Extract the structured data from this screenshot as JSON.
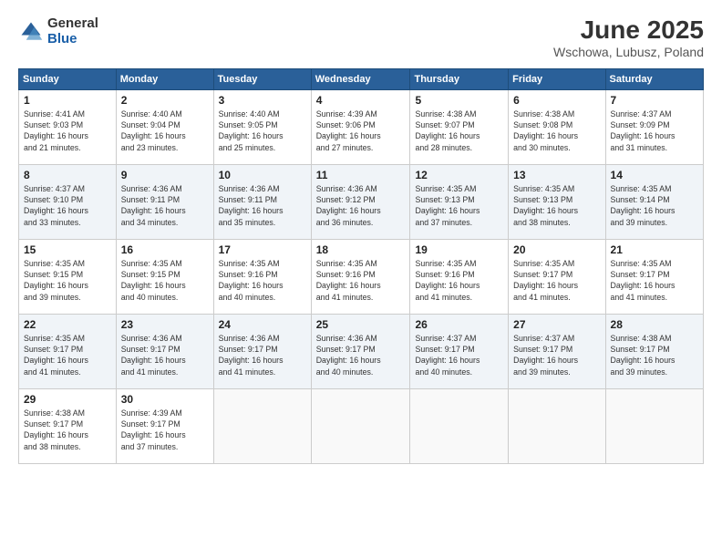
{
  "logo": {
    "line1": "General",
    "line2": "Blue"
  },
  "title": "June 2025",
  "subtitle": "Wschowa, Lubusz, Poland",
  "header_days": [
    "Sunday",
    "Monday",
    "Tuesday",
    "Wednesday",
    "Thursday",
    "Friday",
    "Saturday"
  ],
  "weeks": [
    [
      {
        "day": "1",
        "info": "Sunrise: 4:41 AM\nSunset: 9:03 PM\nDaylight: 16 hours\nand 21 minutes."
      },
      {
        "day": "2",
        "info": "Sunrise: 4:40 AM\nSunset: 9:04 PM\nDaylight: 16 hours\nand 23 minutes."
      },
      {
        "day": "3",
        "info": "Sunrise: 4:40 AM\nSunset: 9:05 PM\nDaylight: 16 hours\nand 25 minutes."
      },
      {
        "day": "4",
        "info": "Sunrise: 4:39 AM\nSunset: 9:06 PM\nDaylight: 16 hours\nand 27 minutes."
      },
      {
        "day": "5",
        "info": "Sunrise: 4:38 AM\nSunset: 9:07 PM\nDaylight: 16 hours\nand 28 minutes."
      },
      {
        "day": "6",
        "info": "Sunrise: 4:38 AM\nSunset: 9:08 PM\nDaylight: 16 hours\nand 30 minutes."
      },
      {
        "day": "7",
        "info": "Sunrise: 4:37 AM\nSunset: 9:09 PM\nDaylight: 16 hours\nand 31 minutes."
      }
    ],
    [
      {
        "day": "8",
        "info": "Sunrise: 4:37 AM\nSunset: 9:10 PM\nDaylight: 16 hours\nand 33 minutes."
      },
      {
        "day": "9",
        "info": "Sunrise: 4:36 AM\nSunset: 9:11 PM\nDaylight: 16 hours\nand 34 minutes."
      },
      {
        "day": "10",
        "info": "Sunrise: 4:36 AM\nSunset: 9:11 PM\nDaylight: 16 hours\nand 35 minutes."
      },
      {
        "day": "11",
        "info": "Sunrise: 4:36 AM\nSunset: 9:12 PM\nDaylight: 16 hours\nand 36 minutes."
      },
      {
        "day": "12",
        "info": "Sunrise: 4:35 AM\nSunset: 9:13 PM\nDaylight: 16 hours\nand 37 minutes."
      },
      {
        "day": "13",
        "info": "Sunrise: 4:35 AM\nSunset: 9:13 PM\nDaylight: 16 hours\nand 38 minutes."
      },
      {
        "day": "14",
        "info": "Sunrise: 4:35 AM\nSunset: 9:14 PM\nDaylight: 16 hours\nand 39 minutes."
      }
    ],
    [
      {
        "day": "15",
        "info": "Sunrise: 4:35 AM\nSunset: 9:15 PM\nDaylight: 16 hours\nand 39 minutes."
      },
      {
        "day": "16",
        "info": "Sunrise: 4:35 AM\nSunset: 9:15 PM\nDaylight: 16 hours\nand 40 minutes."
      },
      {
        "day": "17",
        "info": "Sunrise: 4:35 AM\nSunset: 9:16 PM\nDaylight: 16 hours\nand 40 minutes."
      },
      {
        "day": "18",
        "info": "Sunrise: 4:35 AM\nSunset: 9:16 PM\nDaylight: 16 hours\nand 41 minutes."
      },
      {
        "day": "19",
        "info": "Sunrise: 4:35 AM\nSunset: 9:16 PM\nDaylight: 16 hours\nand 41 minutes."
      },
      {
        "day": "20",
        "info": "Sunrise: 4:35 AM\nSunset: 9:17 PM\nDaylight: 16 hours\nand 41 minutes."
      },
      {
        "day": "21",
        "info": "Sunrise: 4:35 AM\nSunset: 9:17 PM\nDaylight: 16 hours\nand 41 minutes."
      }
    ],
    [
      {
        "day": "22",
        "info": "Sunrise: 4:35 AM\nSunset: 9:17 PM\nDaylight: 16 hours\nand 41 minutes."
      },
      {
        "day": "23",
        "info": "Sunrise: 4:36 AM\nSunset: 9:17 PM\nDaylight: 16 hours\nand 41 minutes."
      },
      {
        "day": "24",
        "info": "Sunrise: 4:36 AM\nSunset: 9:17 PM\nDaylight: 16 hours\nand 41 minutes."
      },
      {
        "day": "25",
        "info": "Sunrise: 4:36 AM\nSunset: 9:17 PM\nDaylight: 16 hours\nand 40 minutes."
      },
      {
        "day": "26",
        "info": "Sunrise: 4:37 AM\nSunset: 9:17 PM\nDaylight: 16 hours\nand 40 minutes."
      },
      {
        "day": "27",
        "info": "Sunrise: 4:37 AM\nSunset: 9:17 PM\nDaylight: 16 hours\nand 39 minutes."
      },
      {
        "day": "28",
        "info": "Sunrise: 4:38 AM\nSunset: 9:17 PM\nDaylight: 16 hours\nand 39 minutes."
      }
    ],
    [
      {
        "day": "29",
        "info": "Sunrise: 4:38 AM\nSunset: 9:17 PM\nDaylight: 16 hours\nand 38 minutes."
      },
      {
        "day": "30",
        "info": "Sunrise: 4:39 AM\nSunset: 9:17 PM\nDaylight: 16 hours\nand 37 minutes."
      },
      null,
      null,
      null,
      null,
      null
    ]
  ]
}
